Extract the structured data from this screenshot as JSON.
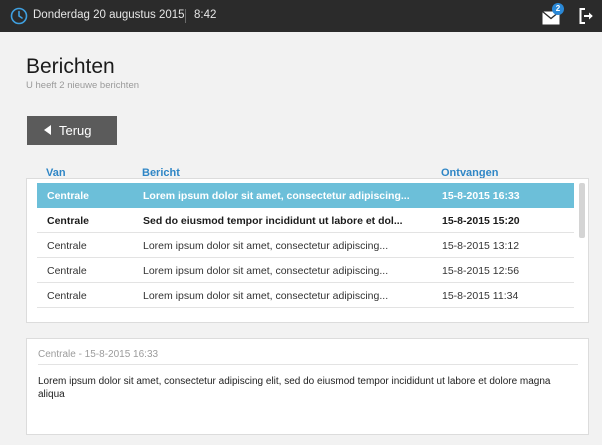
{
  "topbar": {
    "date": "Donderdag 20 augustus 2015",
    "time": "8:42",
    "mail_badge": "2",
    "icons": {
      "clock": "clock-icon",
      "mail": "mail-icon",
      "logout": "logout-icon"
    },
    "background": "#2b2b2b"
  },
  "page": {
    "title": "Berichten",
    "subtitle": "U heeft 2 nieuwe berichten",
    "back_label": "Terug"
  },
  "table": {
    "headers": {
      "van": "Van",
      "bericht": "Bericht",
      "ontvangen": "Ontvangen"
    },
    "rows": [
      {
        "van": "Centrale",
        "bericht": "Lorem ipsum dolor sit amet, consectetur adipiscing...",
        "ontvangen": "15-8-2015 16:33",
        "state": "selected"
      },
      {
        "van": "Centrale",
        "bericht": "Sed do eiusmod tempor incididunt ut labore et dol...",
        "ontvangen": "15-8-2015 15:20",
        "state": "unread"
      },
      {
        "van": "Centrale",
        "bericht": "Lorem ipsum dolor sit amet, consectetur adipiscing...",
        "ontvangen": "15-8-2015 13:12",
        "state": "read"
      },
      {
        "van": "Centrale",
        "bericht": "Lorem ipsum dolor sit amet, consectetur adipiscing...",
        "ontvangen": "15-8-2015 12:56",
        "state": "read"
      },
      {
        "van": "Centrale",
        "bericht": "Lorem ipsum dolor sit amet, consectetur adipiscing...",
        "ontvangen": "15-8-2015 11:34",
        "state": "read"
      }
    ]
  },
  "detail": {
    "meta": "Centrale - 15-8-2015 16:33",
    "body": "Lorem ipsum dolor sit amet, consectetur adipiscing elit, sed do eiusmod tempor incididunt ut labore et dolore magna aliqua"
  },
  "colors": {
    "accent": "#2f86c6",
    "selected_row": "#6cbfd9",
    "button": "#5b5b5b",
    "badge": "#2a88d6"
  }
}
